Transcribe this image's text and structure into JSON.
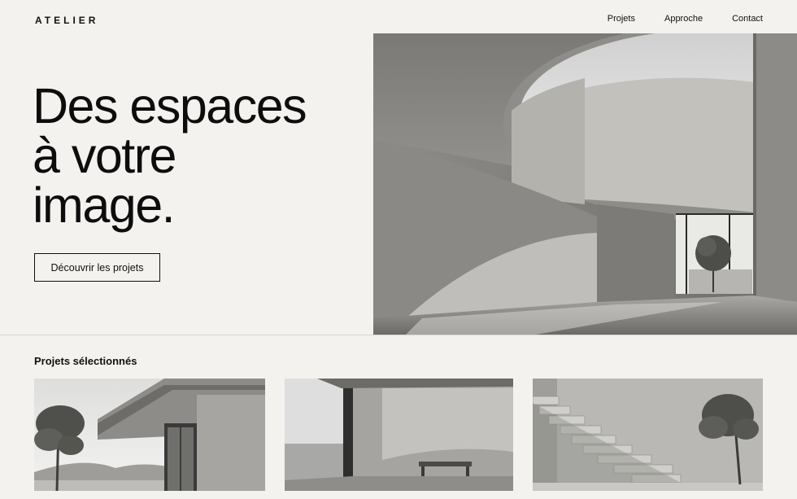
{
  "header": {
    "logo": "ATELIER",
    "nav": [
      {
        "label": "Projets"
      },
      {
        "label": "Approche"
      },
      {
        "label": "Contact"
      }
    ]
  },
  "hero": {
    "title_lines": [
      "Des espaces",
      "à votre",
      "image."
    ],
    "cta_label": "Découvrir les projets"
  },
  "projects": {
    "title": "Projets sélectionnés"
  }
}
